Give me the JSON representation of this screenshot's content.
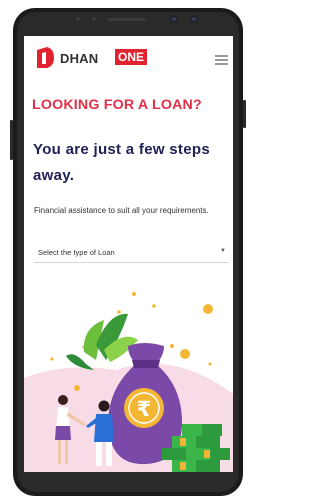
{
  "header": {
    "brand_name": "DHAN",
    "brand_badge": "ONE",
    "menu_icon": "hamburger-menu-icon"
  },
  "hero": {
    "headline": "LOOKING FOR A LOAN?",
    "subheadline": "You are just a few steps away.",
    "description": "Financial assistance to suit all your requirements."
  },
  "form": {
    "loan_type_select": {
      "label": "Select the type of Loan",
      "icon": "caret-down-icon"
    }
  },
  "illustration": {
    "coin_symbol": "₹"
  },
  "colors": {
    "brand_red": "#e0232e",
    "headline_pink": "#e23049",
    "navy": "#1f2055",
    "bag_purple": "#7b4aa8",
    "coin_gold": "#f3b735",
    "cash_green": "#3bb54a"
  }
}
